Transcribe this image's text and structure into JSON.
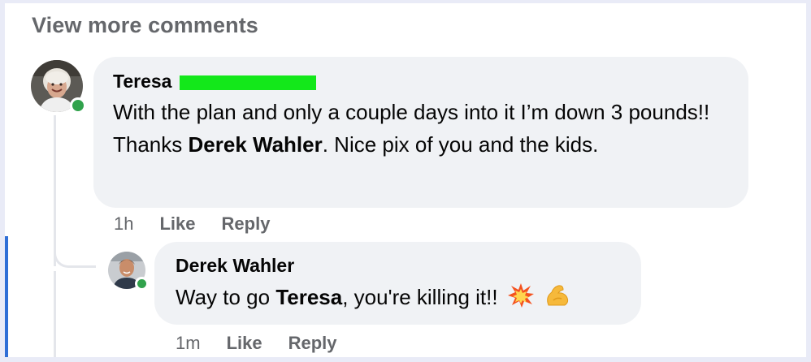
{
  "view_more": "View more comments",
  "comments": [
    {
      "author": "Teresa",
      "text_before": "With the plan and only a couple days into it I’m down 3 pounds!! Thanks ",
      "mention": "Derek Wahler",
      "text_after": ". Nice pix of you and the kids.",
      "time": "1h",
      "like": "Like",
      "reply": "Reply"
    },
    {
      "author": "Derek Wahler",
      "text_before": "Way to go ",
      "mention": "Teresa",
      "text_after": ", you're killing it!!",
      "emojis": [
        "collision-emoji",
        "flexed-biceps-emoji"
      ],
      "time": "1m",
      "like": "Like",
      "reply": "Reply"
    }
  ],
  "colors": {
    "bubble": "#f0f2f5",
    "meta": "#65676b",
    "online": "#31a24c",
    "redaction": "#13e81a",
    "accent": "#2f6fd6"
  }
}
